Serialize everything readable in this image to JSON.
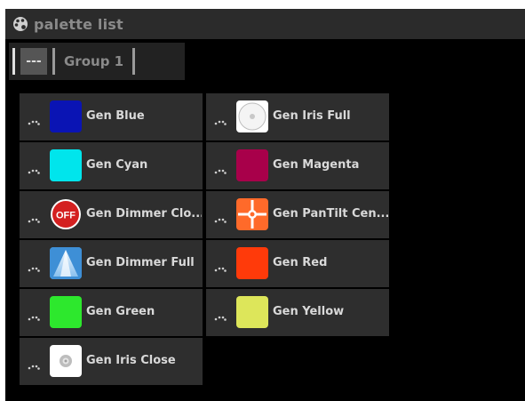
{
  "window": {
    "title": "palette list",
    "title_icon": "palette-icon"
  },
  "tabs": [
    {
      "label": "---",
      "active": true
    },
    {
      "label": "Group 1",
      "active": false
    }
  ],
  "items": [
    {
      "label": "Gen Blue",
      "icon": "color-swatch",
      "color": "#0a14b4"
    },
    {
      "label": "Gen Iris Full",
      "icon": "iris-full-icon",
      "color": "#ffffff"
    },
    {
      "label": "Gen Cyan",
      "icon": "color-swatch",
      "color": "#00e5ec"
    },
    {
      "label": "Gen Magenta",
      "icon": "color-swatch",
      "color": "#a8004a"
    },
    {
      "label": "Gen Dimmer Clo...",
      "icon": "dimmer-off-icon",
      "color": "#d42020"
    },
    {
      "label": "Gen PanTilt Cen...",
      "icon": "pantilt-center-icon",
      "color": "#ff6a2a"
    },
    {
      "label": "Gen Dimmer Full",
      "icon": "dimmer-full-icon",
      "color": "#4fa8e6"
    },
    {
      "label": "Gen Red",
      "icon": "color-swatch",
      "color": "#ff3a0a"
    },
    {
      "label": "Gen Green",
      "icon": "color-swatch",
      "color": "#2de82d"
    },
    {
      "label": "Gen Yellow",
      "icon": "color-swatch",
      "color": "#dde65a"
    },
    {
      "label": "Gen Iris Close",
      "icon": "iris-close-icon",
      "color": "#ffffff"
    }
  ],
  "badge_text": {
    "off": "OFF"
  }
}
